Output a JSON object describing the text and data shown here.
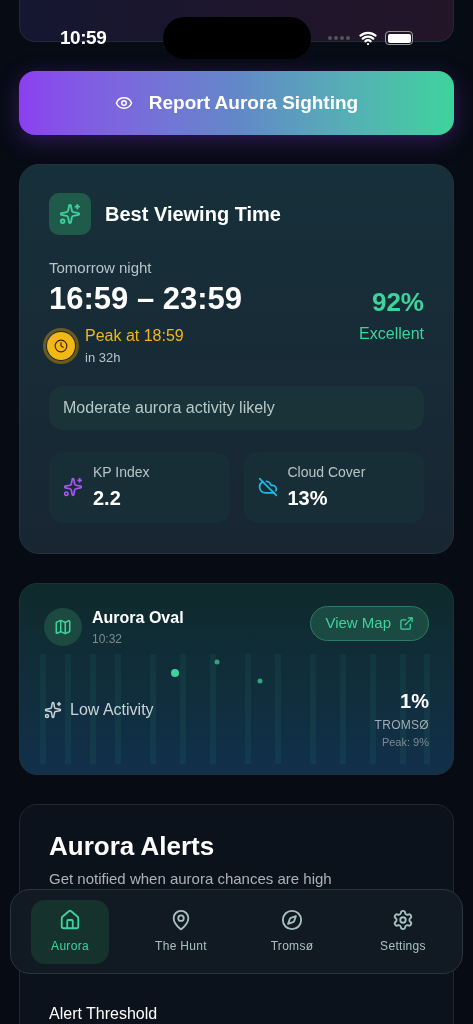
{
  "status_bar": {
    "time": "10:59"
  },
  "report_button": {
    "label": "Report Aurora Sighting"
  },
  "best_viewing": {
    "title": "Best Viewing Time",
    "day": "Tomorrow night",
    "window": "16:59 – 23:59",
    "chance": "92%",
    "rating": "Excellent",
    "peak": "Peak at 18:59",
    "peak_in": "in 32h",
    "summary": "Moderate aurora activity likely",
    "stats": [
      {
        "kind": "kp",
        "label": "KP Index",
        "value": "2.2"
      },
      {
        "kind": "cloud",
        "label": "Cloud Cover",
        "value": "13%"
      }
    ]
  },
  "aurora_oval": {
    "title": "Aurora Oval",
    "time": "10:32",
    "button": "View Map",
    "activity": "Low Activity",
    "percent": "1%",
    "location": "TROMSØ",
    "peak": "Peak: 9%"
  },
  "alerts": {
    "title": "Aurora Alerts",
    "subtitle": "Get notified when aurora chances are high",
    "threshold_label": "Alert Threshold"
  },
  "nav": [
    {
      "kind": "home",
      "label": "Aurora",
      "selected": true
    },
    {
      "kind": "pin",
      "label": "The Hunt",
      "selected": false
    },
    {
      "kind": "compass",
      "label": "Tromsø",
      "selected": false
    },
    {
      "kind": "settings",
      "label": "Settings",
      "selected": false
    }
  ]
}
